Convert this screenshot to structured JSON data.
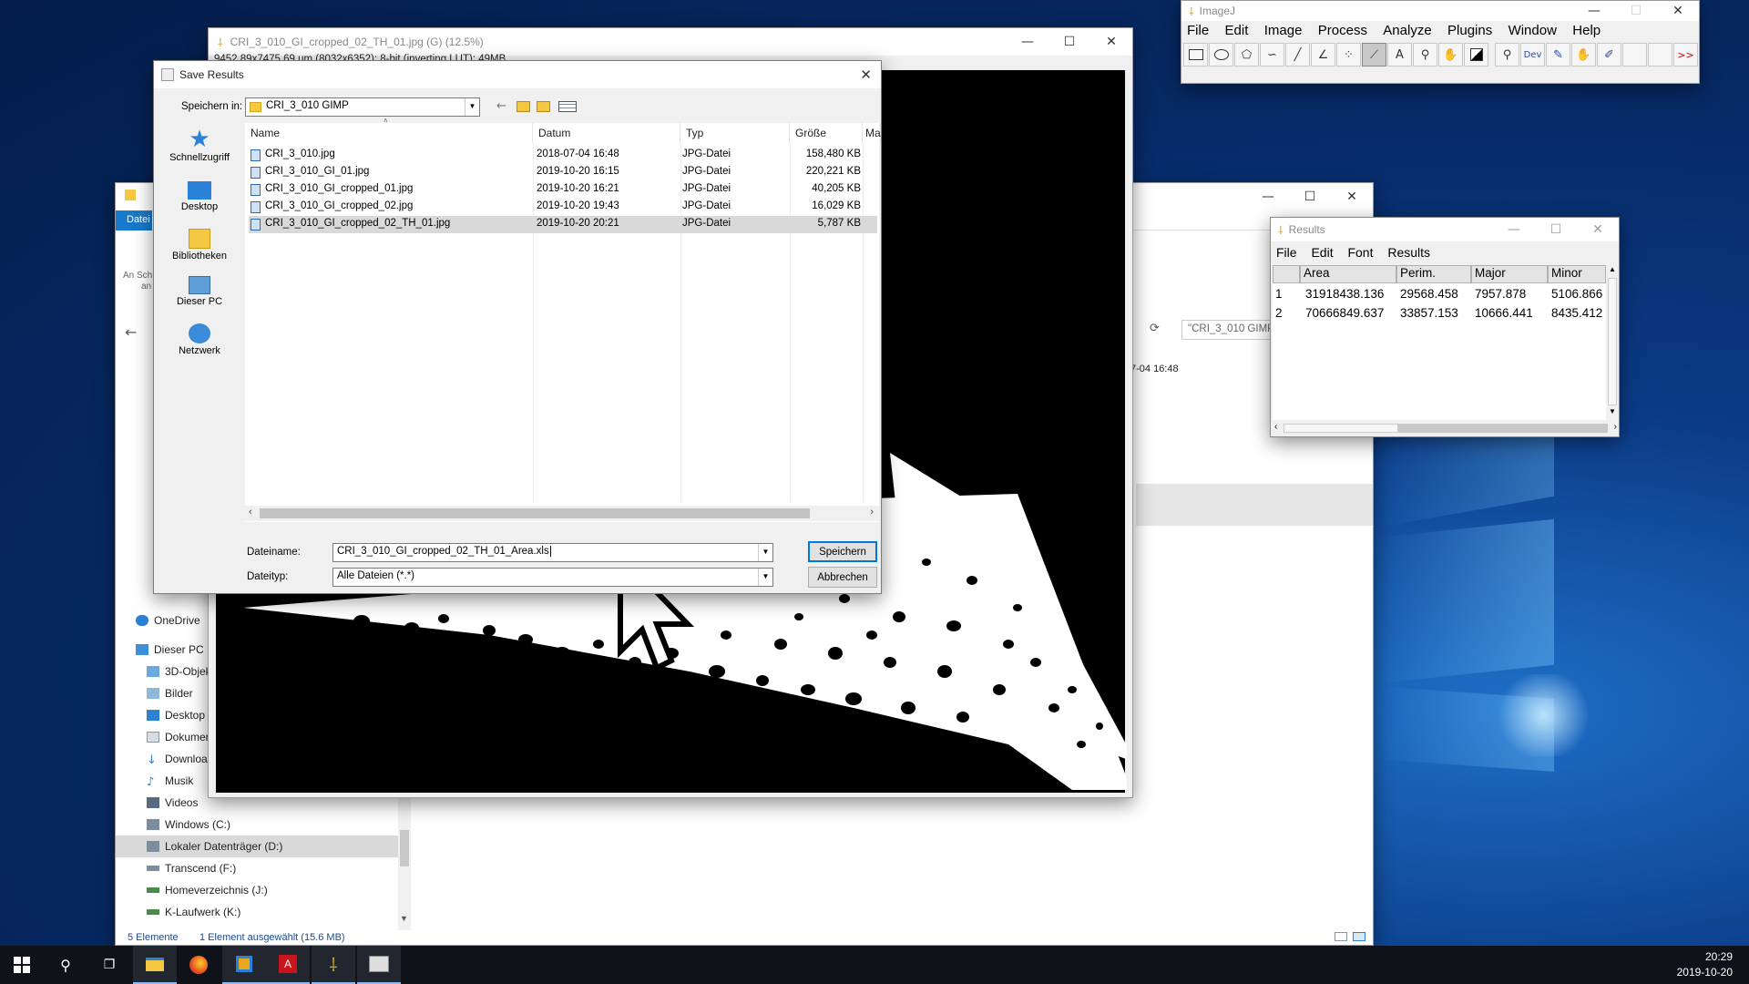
{
  "desktop": {},
  "taskbar": {
    "time": "20:29",
    "date": "2019-10-20",
    "icons": [
      "windows-start-icon",
      "search-icon",
      "task-view-icon",
      "file-explorer-icon",
      "firefox-icon",
      "app-icon",
      "acrobat-icon",
      "imagej-icon",
      "image-app-icon"
    ]
  },
  "explorer": {
    "ribbon_tab": "Datei",
    "pin_hint_1": "An Sch",
    "pin_hint_2": "an",
    "search_placeholder": "\"CRI_3_010 GIMP\"",
    "detail_date": "7-04 16:48",
    "status_items": "5 Elemente",
    "status_selected": "1 Element ausgewählt (15.6 MB)",
    "nav": [
      {
        "label": "OneDrive",
        "icon": "onedrive-icon"
      },
      {
        "label": "Dieser PC",
        "icon": "computer-icon"
      },
      {
        "label": "3D-Objek",
        "icon": "3d-objects-icon"
      },
      {
        "label": "Bilder",
        "icon": "pictures-icon"
      },
      {
        "label": "Desktop",
        "icon": "desktop-icon"
      },
      {
        "label": "Dokumen",
        "icon": "documents-icon"
      },
      {
        "label": "Downloac",
        "icon": "downloads-icon"
      },
      {
        "label": "Musik",
        "icon": "music-icon"
      },
      {
        "label": "Videos",
        "icon": "videos-icon"
      },
      {
        "label": "Windows (C:)",
        "icon": "drive-icon"
      },
      {
        "label": "Lokaler Datenträger (D:)",
        "icon": "drive-icon"
      },
      {
        "label": "Transcend (F:)",
        "icon": "drive-icon"
      },
      {
        "label": "Homeverzeichnis (J:)",
        "icon": "network-drive-icon"
      },
      {
        "label": "K-Laufwerk (K:)",
        "icon": "network-drive-icon"
      }
    ]
  },
  "image_window": {
    "title": "CRI_3_010_GI_cropped_02_TH_01.jpg (G) (12.5%)",
    "info": "9452.89x7475.69 um (8032x6352); 8-bit (inverting LUT); 49MB"
  },
  "save_dialog": {
    "title": "Save Results",
    "look_in_label": "Speichern in:",
    "look_in_value": "CRI_3_010 GIMP",
    "places": [
      "Schnellzugriff",
      "Desktop",
      "Bibliotheken",
      "Dieser PC",
      "Netzwerk"
    ],
    "columns": [
      "Name",
      "Datum",
      "Typ",
      "Größe",
      "Ma"
    ],
    "files": [
      {
        "name": "CRI_3_010.jpg",
        "date": "2018-07-04 16:48",
        "type": "JPG-Datei",
        "size": "158,480 KB"
      },
      {
        "name": "CRI_3_010_GI_01.jpg",
        "date": "2019-10-20 16:15",
        "type": "JPG-Datei",
        "size": "220,221 KB"
      },
      {
        "name": "CRI_3_010_GI_cropped_01.jpg",
        "date": "2019-10-20 16:21",
        "type": "JPG-Datei",
        "size": "40,205 KB"
      },
      {
        "name": "CRI_3_010_GI_cropped_02.jpg",
        "date": "2019-10-20 19:43",
        "type": "JPG-Datei",
        "size": "16,029 KB"
      },
      {
        "name": "CRI_3_010_GI_cropped_02_TH_01.jpg",
        "date": "2019-10-20 20:21",
        "type": "JPG-Datei",
        "size": "5,787 KB"
      }
    ],
    "filename_label": "Dateiname:",
    "filename_value": "CRI_3_010_GI_cropped_02_TH_01_Area.xls",
    "filetype_label": "Dateityp:",
    "filetype_value": "Alle Dateien (*.*)",
    "save_button": "Speichern",
    "cancel_button": "Abbrechen"
  },
  "imagej": {
    "title": "ImageJ",
    "menu": [
      "File",
      "Edit",
      "Image",
      "Process",
      "Analyze",
      "Plugins",
      "Window",
      "Help"
    ],
    "tools": [
      "rectangle-tool-icon",
      "oval-tool-icon",
      "polygon-tool-icon",
      "freehand-tool-icon",
      "line-tool-icon",
      "angle-tool-icon",
      "point-tool-icon",
      "wand-tool-icon",
      "text-tool-icon",
      "magnifier-tool-icon",
      "hand-tool-icon",
      "color-picker-icon",
      "zoom-icon",
      "dev-tool-icon",
      "pencil-icon",
      "brush-icon",
      "pipette-icon",
      "empty-slot-icon",
      "empty-slot-icon",
      "more-tools-icon"
    ],
    "dev_label": "Dev",
    "text_tool_label": "A",
    "more_label": ">>"
  },
  "results": {
    "title": "Results",
    "menu": [
      "File",
      "Edit",
      "Font",
      "Results"
    ],
    "headers": [
      "",
      "Area",
      "Perim.",
      "Major",
      "Minor"
    ],
    "rows": [
      [
        "1",
        "31918438.136",
        "29568.458",
        "7957.878",
        "5106.866"
      ],
      [
        "2",
        "70666849.637",
        "33857.153",
        "10666.441",
        "8435.412"
      ]
    ]
  }
}
